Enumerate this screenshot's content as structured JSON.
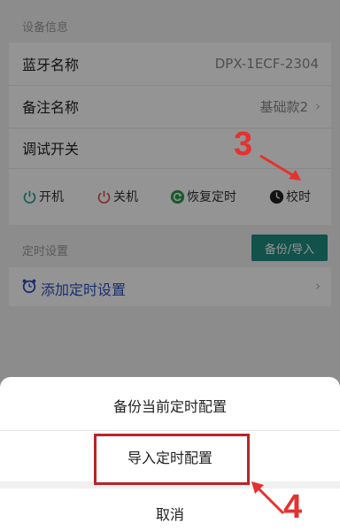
{
  "device_info": {
    "section_label": "设备信息",
    "bluetooth_name_label": "蓝牙名称",
    "bluetooth_name_value": "DPX-1ECF-2304",
    "remark_name_label": "备注名称",
    "remark_name_value": "基础款2",
    "chevron": "›"
  },
  "debug": {
    "title": "调试开关",
    "controls": [
      {
        "label": "开机",
        "icon": "power-icon",
        "color": "#2a9d8f"
      },
      {
        "label": "关机",
        "icon": "power-icon",
        "color": "#d9534f"
      },
      {
        "label": "恢复定时",
        "icon": "refresh-icon",
        "color": "#2e9a4a"
      },
      {
        "label": "校时",
        "icon": "clock-icon",
        "color": "#222222"
      }
    ]
  },
  "timer": {
    "section_label": "定时设置",
    "backup_button": "备份/导入",
    "add_label": "添加定时设置",
    "chevron": "›"
  },
  "sheet": {
    "option_backup": "备份当前定时配置",
    "option_import": "导入定时配置",
    "cancel": "取消"
  },
  "annotations": {
    "step3": "3",
    "step4": "4",
    "color": "#e5312f"
  }
}
